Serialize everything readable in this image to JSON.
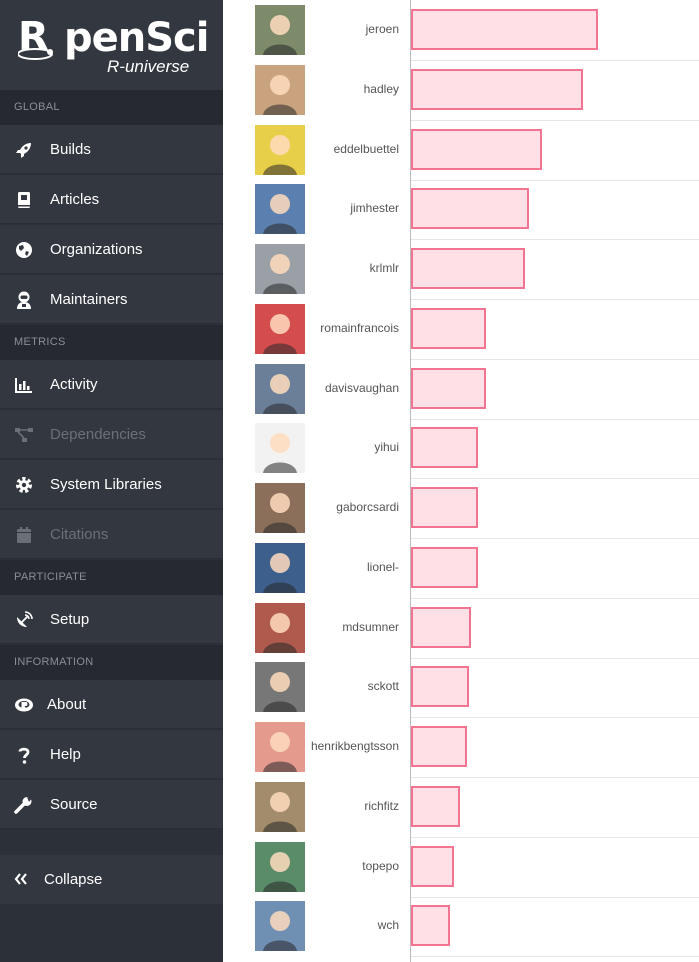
{
  "brand": {
    "title": "penSci",
    "subtitle": "R-universe",
    "colors": {
      "sidebar": "#2c3038",
      "bar_fill": "#ffe0e6",
      "bar_border": "#f27490"
    }
  },
  "sidebar": {
    "sections": [
      {
        "label": "GLOBAL",
        "items": [
          {
            "label": "Builds",
            "icon": "rocket-icon",
            "enabled": true
          },
          {
            "label": "Articles",
            "icon": "book-icon",
            "enabled": true
          },
          {
            "label": "Organizations",
            "icon": "globe-icon",
            "enabled": true
          },
          {
            "label": "Maintainers",
            "icon": "user-astronaut-icon",
            "enabled": true
          }
        ]
      },
      {
        "label": "METRICS",
        "items": [
          {
            "label": "Activity",
            "icon": "chart-bar-icon",
            "enabled": true
          },
          {
            "label": "Dependencies",
            "icon": "sitemap-icon",
            "enabled": false
          },
          {
            "label": "System Libraries",
            "icon": "gear-icon",
            "enabled": true
          },
          {
            "label": "Citations",
            "icon": "calendar-icon",
            "enabled": false
          }
        ]
      },
      {
        "label": "PARTICIPATE",
        "items": [
          {
            "label": "Setup",
            "icon": "satellite-dish-icon",
            "enabled": true
          }
        ]
      },
      {
        "label": "INFORMATION",
        "items": [
          {
            "label": "About",
            "icon": "r-logo-icon",
            "enabled": true
          },
          {
            "label": "Help",
            "icon": "question-icon",
            "enabled": true
          },
          {
            "label": "Source",
            "icon": "wrench-icon",
            "enabled": true
          }
        ]
      }
    ],
    "collapse_label": "Collapse"
  },
  "chart_data": {
    "type": "bar",
    "orientation": "horizontal",
    "categories": [
      "jeroen",
      "hadley",
      "eddelbuettel",
      "jimhester",
      "krlmlr",
      "romainfrancois",
      "davisvaughan",
      "yihui",
      "gaborcsardi",
      "lionel-",
      "mdsumner",
      "sckott",
      "henrikbengtsson",
      "richfitz",
      "topepo",
      "wch"
    ],
    "values": [
      100,
      92,
      70,
      63,
      61,
      40,
      40,
      36,
      36,
      36,
      32,
      31,
      30,
      26,
      23,
      21
    ],
    "value_units": "relative bar length (0–100), no scale shown",
    "title": "",
    "xlabel": "",
    "ylabel": "",
    "grid": "horizontal row separators"
  }
}
